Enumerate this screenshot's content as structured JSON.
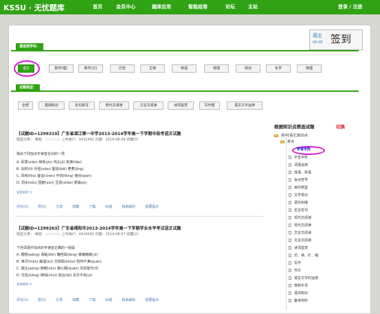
{
  "header": {
    "logo": "KS5U · 无忧题库",
    "nav": [
      "首页",
      "会员中心",
      "题库应用",
      "智能组卷",
      "论坛",
      "主站"
    ],
    "login": "登录 / 注册"
  },
  "sign": {
    "weekday": "周五",
    "date": "08.08",
    "button": "签到"
  },
  "subject_section": {
    "label": "请选择学科：",
    "subjects": [
      "语文",
      "数学(理)",
      "数学(文)",
      "历史",
      "生物",
      "英语",
      "地理",
      "政治",
      "化学",
      "物理"
    ]
  },
  "type_section": {
    "label": "试题类型：",
    "types": [
      "全部",
      "基础知识",
      "名句默写",
      "现代文阅读",
      "文言文阅读",
      "诗词鉴赏",
      "写作题",
      "语文文字运用"
    ]
  },
  "questions": [
    {
      "title": "【试题ID=1299310】广东省湛江第一中学2013-2014学年高一下学期中段考语文试题",
      "meta": "题型分类： 难度：☆☆☆☆☆ 上传用户：3431492 日期：2014-08-08 收藏(0)",
      "body": [
        "我出下列加点字读音全对的一项",
        "A. 凤箫(xiāo)  柳条(jiù)  鸡头(jì)  象笋(liǎo)",
        "B. 刹时(tī)  月侵(xiān)  噩烧(biē)  莠莠(jǐng)",
        "C. 风纯(fǒu)  客运(chen)  作祥(fèng)  坡谷(qian)",
        "D. 洞水(kǒu)  困窘(xùn)  豆贡(shǎo)  栀榀(pì)"
      ],
      "more": "查看解析 ∀",
      "actions": [
        "评论(0)",
        "赞(0)",
        "分享",
        "收藏",
        "下载",
        "纠错",
        "我来解析",
        "我要提示"
      ]
    },
    {
      "title": "【试题ID=1299263】广东省揭阳市2013-2014学年高一下学期学业水平考试语文试题",
      "meta": "题型分类： 难度：☆☆☆☆☆ 上传用户：4418049 日期：2014-08-07 收藏(2)",
      "body": [
        "下列词语中加点的字读音正确的一组是",
        "A. 翱翔(wǎng)  濒临(bīn)  罐桂珠(léng)  暖曦晞暧(yǐ)",
        "B. 津沢(mān)  酗酒(xù)  文缀缀(shǔo)  陪持不满(quán)",
        "C. 猥注(pǒng)  俯瞰(sūn)  黜心贼(quǎn)  风范取代(lǐ)",
        "D. 优佐(kōng)  碑础(chuí)  揣台(lěi)  关乐不尚(yì)"
      ],
      "more": "查看解析 ∀",
      "actions": [
        "评论(0)",
        "赞(0)",
        "分享",
        "收藏",
        "下载",
        "纠错",
        "我来解析",
        "我要提示"
      ]
    }
  ],
  "knowledge": {
    "title": "根据知识点筛选试题",
    "switch": "切换",
    "root": "高中[语文]知识点",
    "branch": "考点",
    "items": [
      "字音字形",
      "字音字形",
      "词语运用",
      "成语、熟语",
      "标点符号",
      "病句类型",
      "文学常识",
      "语句衔接",
      "名言名句",
      "现代文阅读",
      "现代文阅读",
      "文言文阅读",
      "文言文阅读",
      "诗词鉴赏",
      "仿、续、扩、缩",
      "写作",
      "作文",
      "语言文字的运用",
      "修辞手法",
      "语法知识",
      "备考材料"
    ]
  }
}
